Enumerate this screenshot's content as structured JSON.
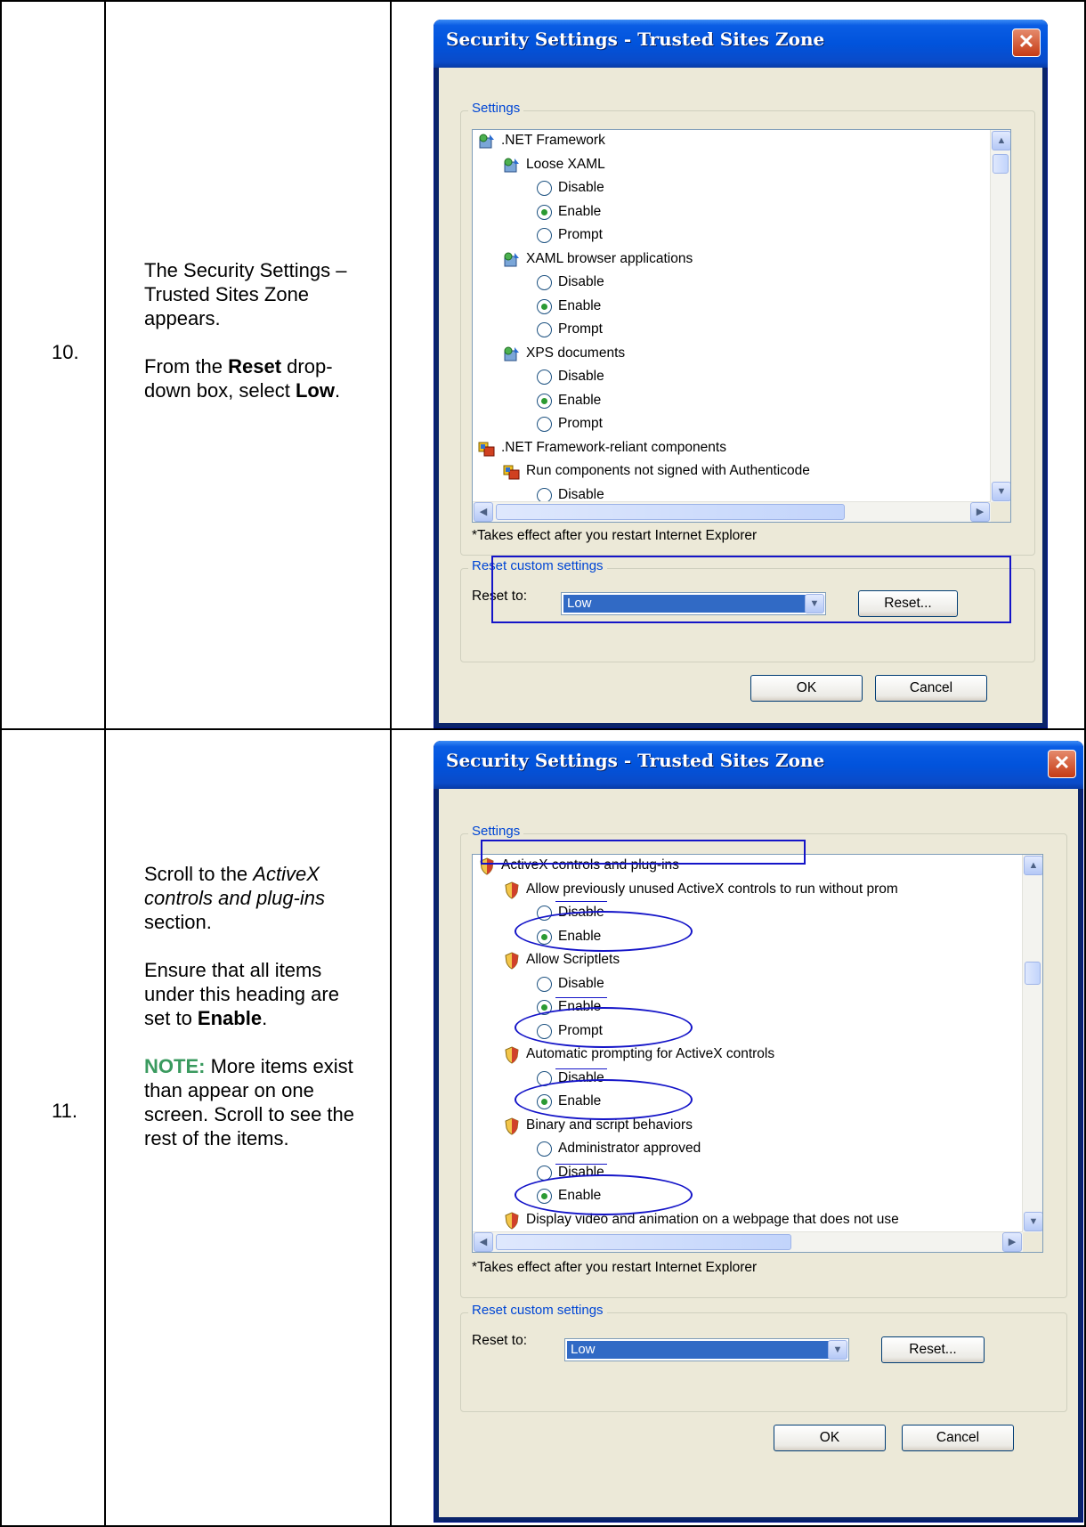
{
  "steps": [
    {
      "number": "10.",
      "instructions": {
        "line1": "The Security Settings –Trusted Sites Zone appears.",
        "p2_pre": "From the ",
        "p2_bold1": "Reset",
        "p2_mid": " drop- down box, select ",
        "p2_bold2": "Low",
        "p2_post": "."
      },
      "dialog": {
        "title": "Security Settings - Trusted Sites Zone",
        "settings_label": "Settings",
        "tree": [
          {
            "type": "category",
            "label": ".NET Framework",
            "icon": "dotnet-icon"
          },
          {
            "type": "item",
            "label": "Loose XAML",
            "icon": "dotnet-icon"
          },
          {
            "type": "option",
            "label": "Disable",
            "selected": false
          },
          {
            "type": "option",
            "label": "Enable",
            "selected": true
          },
          {
            "type": "option",
            "label": "Prompt",
            "selected": false
          },
          {
            "type": "item",
            "label": "XAML browser applications",
            "icon": "dotnet-icon"
          },
          {
            "type": "option",
            "label": "Disable",
            "selected": false
          },
          {
            "type": "option",
            "label": "Enable",
            "selected": true
          },
          {
            "type": "option",
            "label": "Prompt",
            "selected": false
          },
          {
            "type": "item",
            "label": "XPS documents",
            "icon": "dotnet-icon"
          },
          {
            "type": "option",
            "label": "Disable",
            "selected": false
          },
          {
            "type": "option",
            "label": "Enable",
            "selected": true
          },
          {
            "type": "option",
            "label": "Prompt",
            "selected": false
          },
          {
            "type": "category",
            "label": ".NET Framework-reliant components",
            "icon": "components-icon"
          },
          {
            "type": "item",
            "label": "Run components not signed with Authenticode",
            "icon": "components-icon"
          },
          {
            "type": "option",
            "label": "Disable",
            "selected": false
          }
        ],
        "restart_note": "*Takes effect after you restart Internet Explorer",
        "reset_group_label": "Reset custom settings",
        "reset_to_label": "Reset to:",
        "reset_value": "Low",
        "reset_button": "Reset...",
        "ok_button": "OK",
        "cancel_button": "Cancel"
      }
    },
    {
      "number": "11.",
      "instructions": {
        "p1_pre": "Scroll to the ",
        "p1_italic": "ActiveX controls and plug-ins",
        "p1_post": " section.",
        "p2_pre": "Ensure that all items under this heading are set to ",
        "p2_bold": "Enable",
        "p2_post": ".",
        "note_label": "NOTE:",
        "note_text": " More items exist than appear on one screen. Scroll to see the rest of the items."
      },
      "dialog": {
        "title": "Security Settings - Trusted Sites Zone",
        "settings_label": "Settings",
        "tree": [
          {
            "type": "category",
            "label": "ActiveX controls and plug-ins",
            "icon": "shield-icon"
          },
          {
            "type": "item",
            "label": "Allow previously unused ActiveX controls to run without prom",
            "icon": "shield-icon"
          },
          {
            "type": "option",
            "label": "Disable",
            "selected": false
          },
          {
            "type": "option",
            "label": "Enable",
            "selected": true
          },
          {
            "type": "item",
            "label": "Allow Scriptlets",
            "icon": "shield-icon"
          },
          {
            "type": "option",
            "label": "Disable",
            "selected": false
          },
          {
            "type": "option",
            "label": "Enable",
            "selected": true
          },
          {
            "type": "option",
            "label": "Prompt",
            "selected": false
          },
          {
            "type": "item",
            "label": "Automatic prompting for ActiveX controls",
            "icon": "shield-icon"
          },
          {
            "type": "option",
            "label": "Disable",
            "selected": false
          },
          {
            "type": "option",
            "label": "Enable",
            "selected": true
          },
          {
            "type": "item",
            "label": "Binary and script behaviors",
            "icon": "shield-icon"
          },
          {
            "type": "option",
            "label": "Administrator approved",
            "selected": false
          },
          {
            "type": "option",
            "label": "Disable",
            "selected": false
          },
          {
            "type": "option",
            "label": "Enable",
            "selected": true
          },
          {
            "type": "item",
            "label": "Display video and animation on a webpage that does not use",
            "icon": "shield-icon"
          }
        ],
        "restart_note": "*Takes effect after you restart Internet Explorer",
        "reset_group_label": "Reset custom settings",
        "reset_to_label": "Reset to:",
        "reset_value": "Low",
        "reset_button": "Reset...",
        "ok_button": "OK",
        "cancel_button": "Cancel"
      }
    }
  ]
}
